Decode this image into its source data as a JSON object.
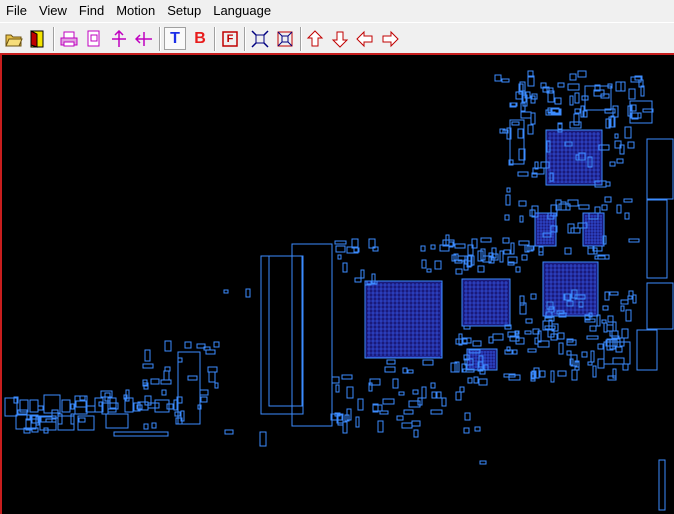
{
  "menu": {
    "file": "File",
    "view": "View",
    "find": "Find",
    "motion": "Motion",
    "setup": "Setup",
    "language": "Language"
  },
  "toolbar": {
    "icons": [
      "open-folder-icon",
      "exit-door-icon",
      "print-icon",
      "zoom-page-icon",
      "flip-vertical-icon",
      "flip-horizontal-icon",
      "top-side-icon",
      "bottom-side-icon",
      "find-icon",
      "zoom-fit-icon",
      "zoom-area-icon",
      "arrow-up-icon",
      "arrow-down-icon",
      "arrow-left-icon",
      "arrow-right-icon"
    ],
    "top_letter": "T",
    "bottom_letter": "B",
    "find_letter": "F",
    "pressed": "top-side-icon"
  },
  "canvas": {
    "background": "#000000",
    "frame_color": "#c81e1e",
    "outline_color": "#3c8cff",
    "chip_fill": "#1a1a7a",
    "chip_grid_color": "#3c64ff"
  }
}
